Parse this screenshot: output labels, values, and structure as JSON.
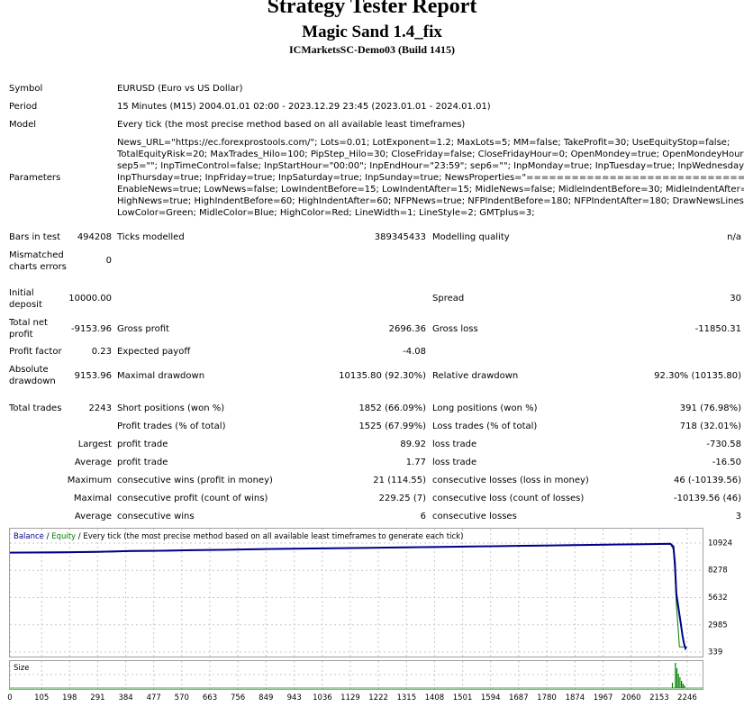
{
  "header": {
    "title": "Strategy Tester Report",
    "expert": "Magic Sand 1.4_fix",
    "server": "ICMarketsSC-Demo03 (Build 1415)"
  },
  "info": {
    "symbol_label": "Symbol",
    "symbol_value": "EURUSD (Euro vs US Dollar)",
    "period_label": "Period",
    "period_value": "15 Minutes (M15) 2004.01.01 02:00 - 2023.12.29 23:45 (2023.01.01 - 2024.01.01)",
    "model_label": "Model",
    "model_value": "Every tick (the most precise method based on all available least timeframes)",
    "parameters_label": "Parameters",
    "parameters_lines": [
      "News_URL=\"https://ec.forexprostools.com/\"; Lots=0.01; LotExponent=1.2; MaxLots=5; MM=false; TakeProfit=30; UseEquityStop=false;",
      "TotalEquityRisk=20; MaxTrades_Hilo=100; PipStep_Hilo=30; CloseFriday=false; CloseFridayHour=0; OpenMondey=true; OpenMondeyHour=0;",
      "sep5=\"\"; InpTimeControl=false; InpStartHour=\"00:00\"; InpEndHour=\"23:59\"; sep6=\"\"; InpMonday=true; InpTuesday=true; InpWednesday=true;",
      "InpThursday=true; InpFriday=true; InpSaturday=true; InpSunday=true; NewsProperties=\"================================\";",
      "EnableNews=true; LowNews=false; LowIndentBefore=15; LowIndentAfter=15; MidleNews=false; MidleIndentBefore=30; MidleIndentAfter=30;",
      "HighNews=true; HighIndentBefore=60; HighIndentAfter=60; NFPNews=true; NFPIndentBefore=180; NFPIndentAfter=180; DrawNewsLines=true;",
      "LowColor=Green; MidleColor=Blue; HighColor=Red; LineWidth=1; LineStyle=2; GMTplus=3;"
    ]
  },
  "stats": {
    "bars_label": "Bars in test",
    "bars_value": "494208",
    "ticks_label": "Ticks modelled",
    "ticks_value": "389345433",
    "quality_label": "Modelling quality",
    "quality_value": "n/a",
    "mismatch_label_1": "Mismatched",
    "mismatch_label_2": "charts errors",
    "mismatch_value": "0",
    "deposit_label_1": "Initial",
    "deposit_label_2": "deposit",
    "deposit_value": "10000.00",
    "spread_label": "Spread",
    "spread_value": "30",
    "netprofit_label_1": "Total net",
    "netprofit_label_2": "profit",
    "netprofit_value": "-9153.96",
    "grossprofit_label": "Gross profit",
    "grossprofit_value": "2696.36",
    "grossloss_label": "Gross loss",
    "grossloss_value": "-11850.31",
    "pf_label": "Profit factor",
    "pf_value": "0.23",
    "payoff_label": "Expected payoff",
    "payoff_value": "-4.08",
    "absdd_label_1": "Absolute",
    "absdd_label_2": "drawdown",
    "absdd_value": "9153.96",
    "maxdd_label": "Maximal drawdown",
    "maxdd_value": "10135.80 (92.30%)",
    "reldd_label": "Relative drawdown",
    "reldd_value": "92.30% (10135.80)",
    "trades_label": "Total trades",
    "trades_value": "2243",
    "short_label": "Short positions (won %)",
    "short_value": "1852 (66.09%)",
    "long_label": "Long positions (won %)",
    "long_value": "391 (76.98%)",
    "ptrades_label": "Profit trades (% of total)",
    "ptrades_value": "1525 (67.99%)",
    "ltrades_label": "Loss trades (% of total)",
    "ltrades_value": "718 (32.01%)",
    "largest_label": "Largest",
    "largest_profit_label": "profit trade",
    "largest_profit_value": "89.92",
    "largest_loss_label": "loss trade",
    "largest_loss_value": "-730.58",
    "average_label": "Average",
    "average_profit_label": "profit trade",
    "average_profit_value": "1.77",
    "average_loss_label": "loss trade",
    "average_loss_value": "-16.50",
    "maximum_label": "Maximum",
    "max_wins_label": "consecutive wins (profit in money)",
    "max_wins_value": "21 (114.55)",
    "max_losses_label": "consecutive losses (loss in money)",
    "max_losses_value": "46 (-10139.56)",
    "maximal_label": "Maximal",
    "maximal_profit_label": "consecutive profit (count of wins)",
    "maximal_profit_value": "229.25 (7)",
    "maximal_loss_label": "consecutive loss (count of losses)",
    "maximal_loss_value": "-10139.56 (46)",
    "avgcons_label": "Average",
    "avg_wins_label": "consecutive wins",
    "avg_wins_value": "6",
    "avg_losses_label": "consecutive losses",
    "avg_losses_value": "3"
  },
  "chart_data": {
    "type": "line",
    "legend": {
      "balance": "Balance",
      "sep1": " / ",
      "equity": "Equity",
      "sep2": " / ",
      "model": "Every tick (the most precise method based on all available least timeframes to generate each tick)"
    },
    "size_label": "Size",
    "y_ticks": [
      10924,
      8278,
      5632,
      2985,
      339
    ],
    "ylim": [
      339,
      10924
    ],
    "x_ticks": [
      0,
      105,
      198,
      291,
      384,
      477,
      570,
      663,
      756,
      849,
      943,
      1036,
      1129,
      1222,
      1315,
      1408,
      1501,
      1594,
      1687,
      1780,
      1874,
      1967,
      2060,
      2153,
      2246
    ],
    "xlim": [
      0,
      2246
    ],
    "grid": true,
    "colors": {
      "balance": "#00008b",
      "equity": "#008000",
      "size": "#008000"
    },
    "series": [
      {
        "name": "Balance",
        "x": [
          0,
          100,
          200,
          300,
          400,
          500,
          600,
          700,
          800,
          900,
          1000,
          1100,
          1200,
          1300,
          1400,
          1500,
          1600,
          1700,
          1800,
          1900,
          2000,
          2100,
          2150,
          2190,
          2200,
          2205,
          2210,
          2215,
          2220,
          2225,
          2230,
          2235,
          2240,
          2243
        ],
        "y": [
          10000,
          10010,
          10040,
          10080,
          10150,
          10180,
          10230,
          10270,
          10320,
          10360,
          10400,
          10430,
          10470,
          10500,
          10540,
          10580,
          10620,
          10660,
          10700,
          10740,
          10780,
          10820,
          10840,
          10850,
          10600,
          9000,
          6000,
          5000,
          4000,
          3000,
          2000,
          1200,
          700,
          846
        ]
      },
      {
        "name": "Equity",
        "x": [
          0,
          100,
          200,
          300,
          400,
          500,
          600,
          700,
          800,
          900,
          1000,
          1100,
          1200,
          1300,
          1400,
          1500,
          1600,
          1700,
          1800,
          1900,
          2000,
          2100,
          2150,
          2190,
          2200,
          2205,
          2210,
          2215,
          2220,
          2240,
          2243
        ],
        "y": [
          10000,
          9960,
          10000,
          10040,
          10110,
          10140,
          10200,
          10240,
          10290,
          10330,
          10370,
          10400,
          10440,
          10470,
          10510,
          10550,
          10590,
          10630,
          10670,
          10710,
          10750,
          10790,
          10810,
          10830,
          10300,
          8000,
          5000,
          3000,
          850,
          850,
          846
        ]
      }
    ]
  }
}
